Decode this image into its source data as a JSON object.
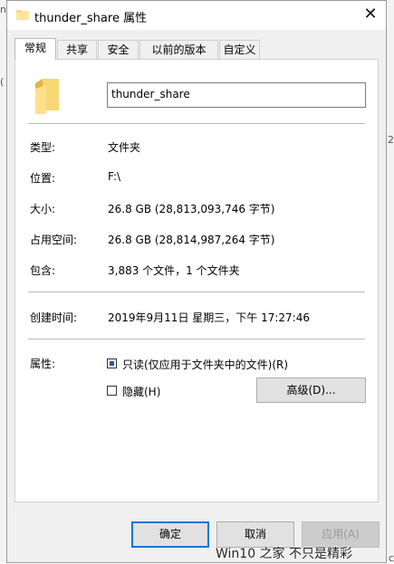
{
  "window": {
    "title": "thunder_share 属性",
    "close_glyph": "✕"
  },
  "tabs": [
    {
      "label": "常规",
      "active": true
    },
    {
      "label": "共享"
    },
    {
      "label": "安全"
    },
    {
      "label": "以前的版本"
    },
    {
      "label": "自定义"
    }
  ],
  "general": {
    "folder_name": "thunder_share",
    "type_label": "类型:",
    "type_value": "文件夹",
    "location_label": "位置:",
    "location_value": "F:\\",
    "size_label": "大小:",
    "size_value": "26.8 GB (28,813,093,746 字节)",
    "disk_size_label": "占用空间:",
    "disk_size_value": "26.8 GB (28,814,987,264 字节)",
    "contains_label": "包含:",
    "contains_value": "3,883 个文件，1 个文件夹",
    "created_label": "创建时间:",
    "created_value": "2019年9月11日 星期三，下午 17:27:46",
    "attributes_label": "属性:",
    "readonly_label": "只读(仅应用于文件夹中的文件)(R)",
    "hidden_label": "隐藏(H)",
    "advanced_label": "高级(D)..."
  },
  "buttons": {
    "ok": "确定",
    "cancel": "取消",
    "apply": "应用(A)"
  },
  "watermark": "Win10 之家 不只是精彩",
  "edge_text": {
    "left_top": "na",
    "left_mid": "(",
    "right_a": ":2",
    "right_b": "c"
  },
  "colors": {
    "folder": "#f8d775",
    "accent": "#0078d7"
  },
  "icons": [
    "folder-icon",
    "close-icon",
    "checkbox-icon"
  ]
}
